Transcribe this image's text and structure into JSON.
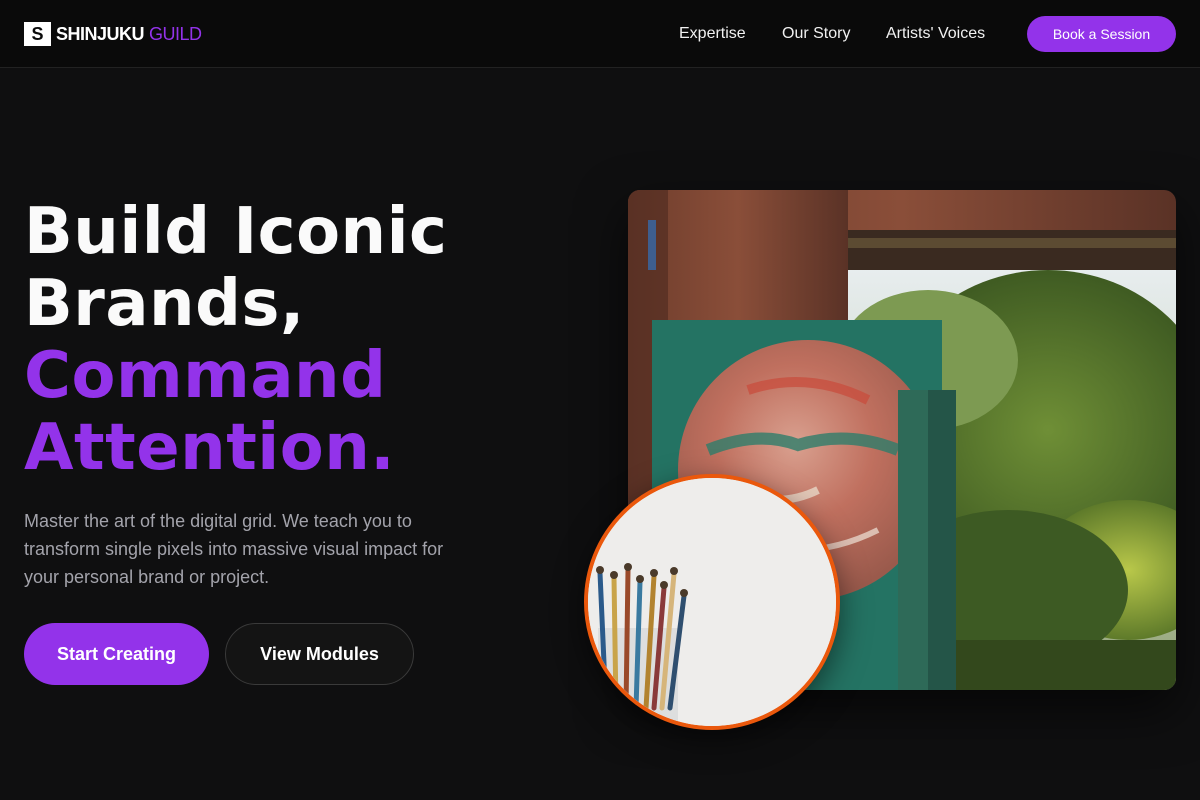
{
  "nav": {
    "logo_mark": "S",
    "logo_word": "SHINJUKU",
    "logo_accent": "GUILD",
    "links": [
      "Expertise",
      "Our Story",
      "Artists' Voices"
    ],
    "cta": "Book a Session"
  },
  "hero": {
    "headline_lines": [
      "Build Iconic",
      "Brands,",
      "Command",
      "Attention."
    ],
    "subtitle": "Master the art of the digital grid. We teach you to transform single pixels into massive visual impact for your personal brand or project.",
    "primary_button": "Start Creating",
    "secondary_button": "View Modules"
  },
  "images": {
    "main_photo": "painted-canvas-in-window-photo",
    "circle_photo": "paint-brushes-in-jar-photo"
  },
  "colors": {
    "accent": "#9333ea",
    "ring": "#ea580c",
    "background": "#0f0f10"
  }
}
